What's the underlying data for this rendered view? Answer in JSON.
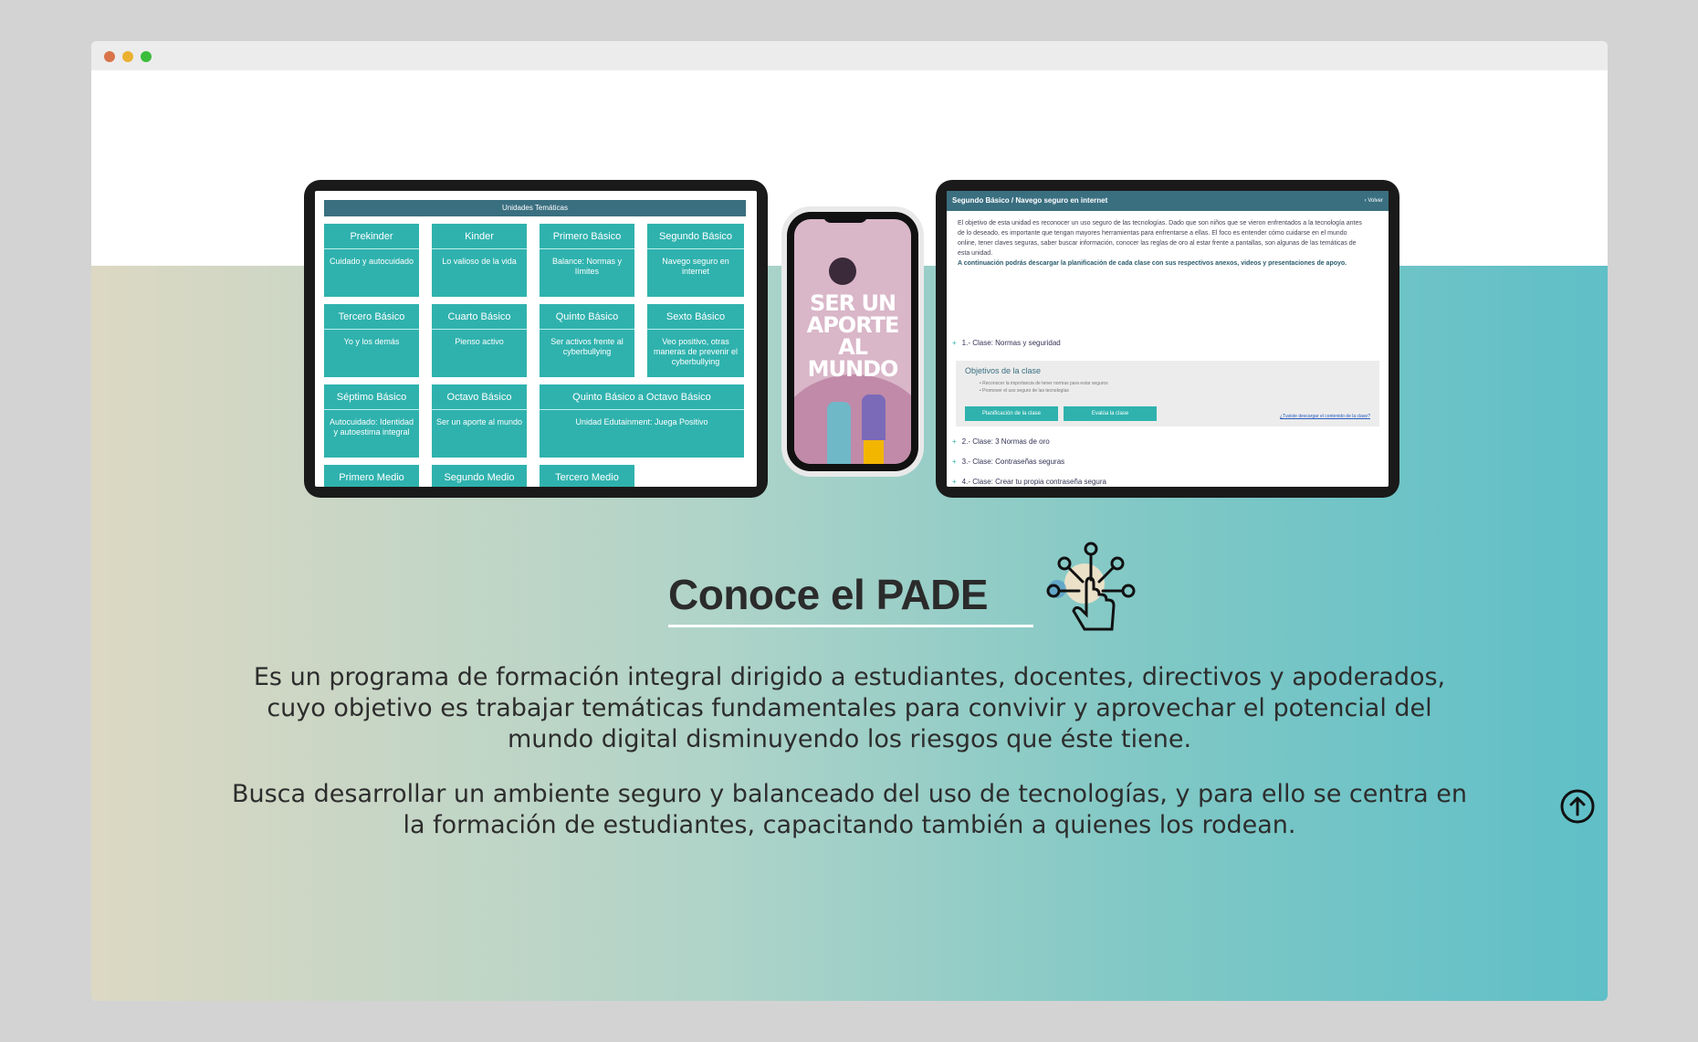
{
  "left_tablet": {
    "header": "Unidades Temáticas",
    "tiles": [
      {
        "title": "Prekinder",
        "subtitle": "Cuidado y autocuidado"
      },
      {
        "title": "Kinder",
        "subtitle": "Lo valioso de la vida"
      },
      {
        "title": "Primero Básico",
        "subtitle": "Balance: Normas y límites"
      },
      {
        "title": "Segundo Básico",
        "subtitle": "Navego seguro en internet"
      },
      {
        "title": "Tercero Básico",
        "subtitle": "Yo y los demás"
      },
      {
        "title": "Cuarto Básico",
        "subtitle": "Pienso activo"
      },
      {
        "title": "Quinto Básico",
        "subtitle": "Ser activos frente al cyberbullying"
      },
      {
        "title": "Sexto Básico",
        "subtitle": "Veo positivo, otras maneras de prevenir el cyberbullying"
      },
      {
        "title": "Séptimo Básico",
        "subtitle": "Autocuidado: Identidad y autoestima integral"
      },
      {
        "title": "Octavo Básico",
        "subtitle": "Ser un aporte al mundo"
      },
      {
        "title": "Quinto Básico a Octavo Básico",
        "subtitle": "Unidad Edutainment: Juega Positivo"
      },
      {
        "title": "Primero Medio",
        "subtitle": ""
      },
      {
        "title": "Segundo Medio",
        "subtitle": ""
      },
      {
        "title": "Tercero Medio",
        "subtitle": ""
      }
    ]
  },
  "phone": {
    "title": "SER UN APORTE AL MUNDO"
  },
  "right_tablet": {
    "header": "Segundo Básico / Navego seguro en internet",
    "back_label": "Volver",
    "description": "El objetivo de esta unidad es reconocer un uso seguro de las tecnologías. Dado que son niños que se vieron enfrentados a la tecnología antes de lo deseado, es importante que tengan mayores herramientas para enfrentarse a ellas. El foco es entender cómo cuidarse en el mundo online, tener claves seguras, saber buscar información, conocer las reglas de oro al estar frente a pantallas, son algunas de las temáticas de esta unidad.",
    "download_note": "A continuación podrás descargar la planificación de cada clase con sus respectivos anexos, videos y presentaciones de apoyo.",
    "classes": [
      "1.- Clase: Normas y seguridad",
      "2.- Clase: 3 Normas de oro",
      "3.- Clase: Contraseñas seguras",
      "4.- Clase: Crear tu propia contraseña segura"
    ],
    "objectives_title": "Objetivos de la clase",
    "objectives": [
      "Reconocer la importancia de tener normas para estar seguros",
      "Promover el uso seguro de las tecnologías"
    ],
    "btn_plan": "Planificación de la clase",
    "btn_eval": "Evalúa la clase",
    "link_text": "¿Tuviste descargar el contenido de la clase?"
  },
  "section": {
    "title": "Conoce el PADE",
    "paragraph1": "Es un programa de formación integral dirigido a estudiantes, docentes, directivos y apoderados, cuyo objetivo es trabajar temáticas fundamentales para convivir y aprovechar el potencial del mundo digital disminuyendo los riesgos que éste tiene.",
    "paragraph2": "Busca desarrollar un ambiente seguro y balanceado del uso de tecnologías, y para ello se centra en la formación de estudiantes, capacitando también a quienes los rodean."
  },
  "icons": {
    "touch": "touch-network-icon",
    "scroll_top": "arrow-up-circle-icon"
  }
}
